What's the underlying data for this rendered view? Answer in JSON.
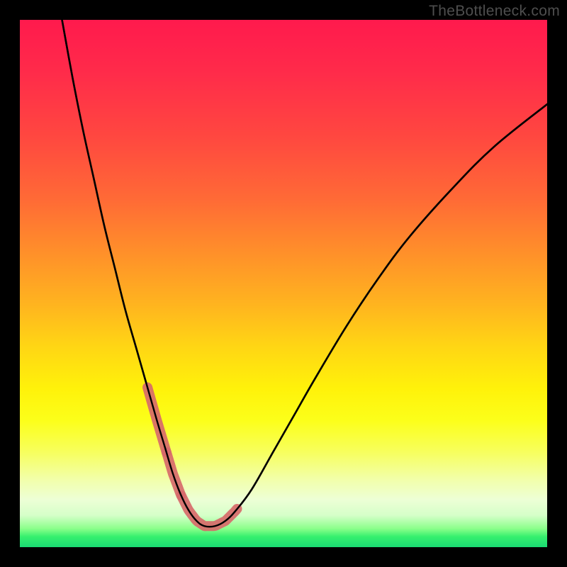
{
  "watermark": "TheBottleneck.com",
  "chart_data": {
    "type": "line",
    "title": "",
    "xlabel": "",
    "ylabel": "",
    "xlim": [
      0,
      100
    ],
    "ylim": [
      0,
      100
    ],
    "curve": {
      "x": [
        8,
        10,
        12,
        14,
        16,
        18,
        20,
        22,
        24,
        26,
        27.5,
        29,
        30.5,
        32,
        33.5,
        35,
        37,
        39,
        41,
        44,
        48,
        52,
        56,
        62,
        68,
        74,
        82,
        90,
        100
      ],
      "y": [
        100,
        89,
        79,
        70,
        61,
        53,
        45,
        38,
        31,
        24,
        19,
        14,
        10,
        7,
        5,
        4,
        4,
        5,
        7,
        11,
        18,
        25,
        32,
        42,
        51,
        59,
        68,
        76,
        84
      ]
    },
    "highlight_segments_x": [
      [
        24.2,
        27.8
      ],
      [
        30.6,
        41.2
      ]
    ],
    "highlight_segment_y_approx": {
      "left_start": 30.5,
      "left_end": 17.0,
      "right_start": 10.0,
      "right_end": 7.5
    },
    "flat_bottom_y": 4,
    "colors": {
      "curve": "#000000",
      "highlight": "#d76a6a",
      "gradient_top": "#ff1a4d",
      "gradient_mid": "#ffe000",
      "gradient_bottom": "#1adb73",
      "frame": "#000000"
    }
  }
}
